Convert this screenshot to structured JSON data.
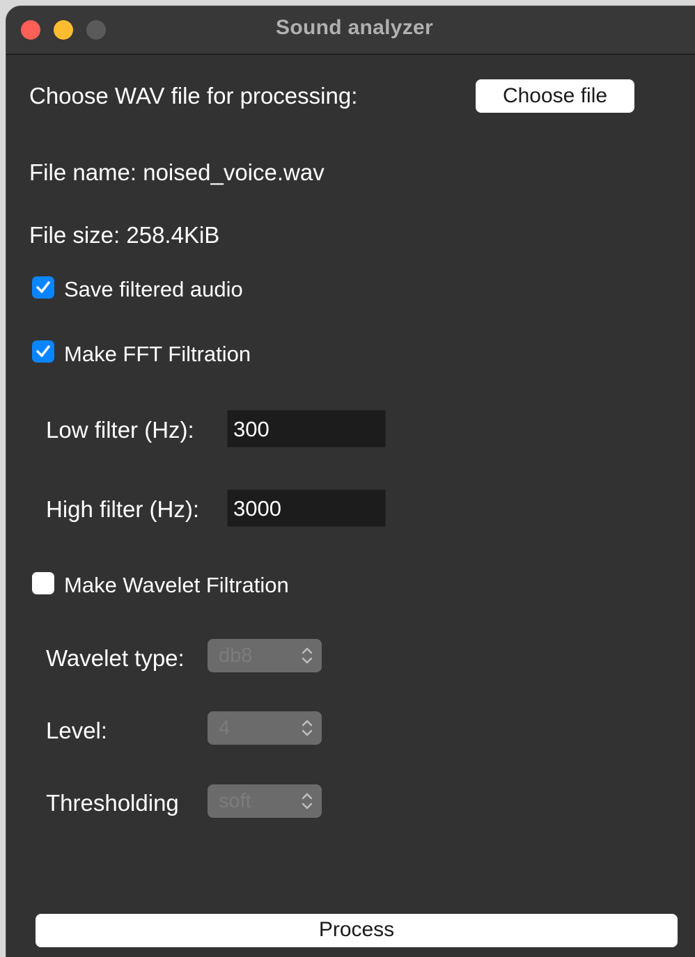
{
  "window": {
    "title": "Sound analyzer",
    "controls": [
      "close",
      "minimize",
      "maximize"
    ]
  },
  "file_section": {
    "prompt": "Choose WAV file for processing:",
    "choose_button": "Choose file",
    "file_name": "File name: noised_voice.wav",
    "file_size": "File size: 258.4KiB"
  },
  "options": {
    "save_filtered": {
      "label": "Save filtered audio",
      "checked": true
    },
    "fft": {
      "label": "Make FFT Filtration",
      "checked": true
    },
    "wavelet": {
      "label": "Make Wavelet Filtration",
      "checked": false
    }
  },
  "fft_params": {
    "low_label": "Low filter (Hz):",
    "low_value": "300",
    "high_label": "High filter (Hz):",
    "high_value": "3000"
  },
  "wavelet_params": {
    "type_label": "Wavelet type:",
    "type_value": "db8",
    "level_label": "Level:",
    "level_value": "4",
    "threshold_label": "Thresholding",
    "threshold_value": "soft",
    "enabled": false
  },
  "actions": {
    "process_button": "Process"
  },
  "colors": {
    "window_bg": "#323232",
    "accent": "#0a84ff",
    "close": "#fe5f57",
    "minimize": "#febc2e"
  },
  "icons": {
    "checkmark": "checkmark-icon",
    "select_arrows": "chevron-up-down-icon"
  }
}
